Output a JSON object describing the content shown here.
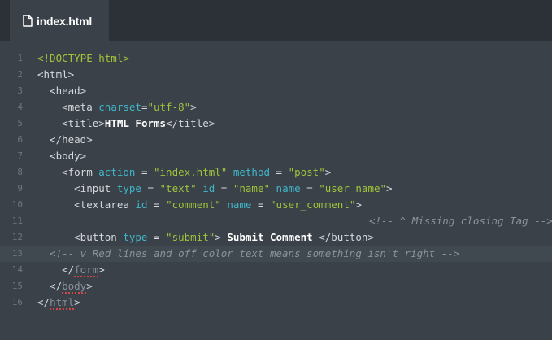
{
  "tab": {
    "icon": "file-icon",
    "label": "index.html"
  },
  "editor": {
    "lines": [
      {
        "num": "1",
        "content": [
          {
            "c": "dt",
            "t": "<!DOCTYPE html>"
          }
        ]
      },
      {
        "num": "2",
        "content": [
          {
            "c": "t",
            "t": "<html>"
          }
        ]
      },
      {
        "num": "3",
        "content": [
          {
            "c": "t",
            "t": "  <head>"
          }
        ]
      },
      {
        "num": "4",
        "content": [
          {
            "c": "t",
            "t": "    <meta "
          },
          {
            "c": "a",
            "t": "charset"
          },
          {
            "c": "t",
            "t": "="
          },
          {
            "c": "s",
            "t": "\"utf-8\""
          },
          {
            "c": "t",
            "t": ">"
          }
        ]
      },
      {
        "num": "5",
        "content": [
          {
            "c": "t",
            "t": "    <title>"
          },
          {
            "c": "w",
            "t": "HTML Forms"
          },
          {
            "c": "t",
            "t": "</title>"
          }
        ]
      },
      {
        "num": "6",
        "content": [
          {
            "c": "t",
            "t": "  </head>"
          }
        ]
      },
      {
        "num": "7",
        "content": [
          {
            "c": "t",
            "t": "  <body>"
          }
        ]
      },
      {
        "num": "8",
        "content": [
          {
            "c": "t",
            "t": "    <form "
          },
          {
            "c": "a",
            "t": "action"
          },
          {
            "c": "t",
            "t": " = "
          },
          {
            "c": "s",
            "t": "\"index.html\""
          },
          {
            "c": "t",
            "t": " "
          },
          {
            "c": "a",
            "t": "method"
          },
          {
            "c": "t",
            "t": " = "
          },
          {
            "c": "s",
            "t": "\"post\""
          },
          {
            "c": "t",
            "t": ">"
          }
        ]
      },
      {
        "num": "9",
        "content": [
          {
            "c": "t",
            "t": "      <input "
          },
          {
            "c": "a",
            "t": "type"
          },
          {
            "c": "t",
            "t": " = "
          },
          {
            "c": "s",
            "t": "\"text\""
          },
          {
            "c": "t",
            "t": " "
          },
          {
            "c": "a",
            "t": "id"
          },
          {
            "c": "t",
            "t": " = "
          },
          {
            "c": "s",
            "t": "\"name\""
          },
          {
            "c": "t",
            "t": " "
          },
          {
            "c": "a",
            "t": "name"
          },
          {
            "c": "t",
            "t": " = "
          },
          {
            "c": "s",
            "t": "\"user_name\""
          },
          {
            "c": "t",
            "t": ">"
          }
        ]
      },
      {
        "num": "10",
        "content": [
          {
            "c": "t",
            "t": "      <textarea "
          },
          {
            "c": "a",
            "t": "id"
          },
          {
            "c": "t",
            "t": " = "
          },
          {
            "c": "s",
            "t": "\"comment\""
          },
          {
            "c": "t",
            "t": " "
          },
          {
            "c": "a",
            "t": "name"
          },
          {
            "c": "t",
            "t": " = "
          },
          {
            "c": "s",
            "t": "\"user_comment\""
          },
          {
            "c": "t",
            "t": ">"
          }
        ]
      },
      {
        "num": "11",
        "content": [],
        "right_comment": "<!-- ^ Missing closing Tag -->"
      },
      {
        "num": "12",
        "content": [
          {
            "c": "t",
            "t": "      <button "
          },
          {
            "c": "a",
            "t": "type"
          },
          {
            "c": "t",
            "t": " = "
          },
          {
            "c": "s",
            "t": "\"submit\""
          },
          {
            "c": "t",
            "t": "> "
          },
          {
            "c": "w",
            "t": "Submit Comment"
          },
          {
            "c": "t",
            "t": " </button>"
          }
        ]
      },
      {
        "num": "13",
        "active": true,
        "content": [
          {
            "c": "cm",
            "t": "  <!-- v Red lines and off color text means something isn't right -->"
          }
        ]
      },
      {
        "num": "14",
        "content": [
          {
            "c": "t",
            "t": "    </"
          },
          {
            "c": "err",
            "t": "form"
          },
          {
            "c": "t",
            "t": ">"
          }
        ]
      },
      {
        "num": "15",
        "content": [
          {
            "c": "t",
            "t": "  </"
          },
          {
            "c": "err",
            "t": "body"
          },
          {
            "c": "t",
            "t": ">"
          }
        ]
      },
      {
        "num": "16",
        "content": [
          {
            "c": "t",
            "t": "</"
          },
          {
            "c": "err",
            "t": "html"
          },
          {
            "c": "t",
            "t": ">"
          }
        ]
      }
    ]
  }
}
